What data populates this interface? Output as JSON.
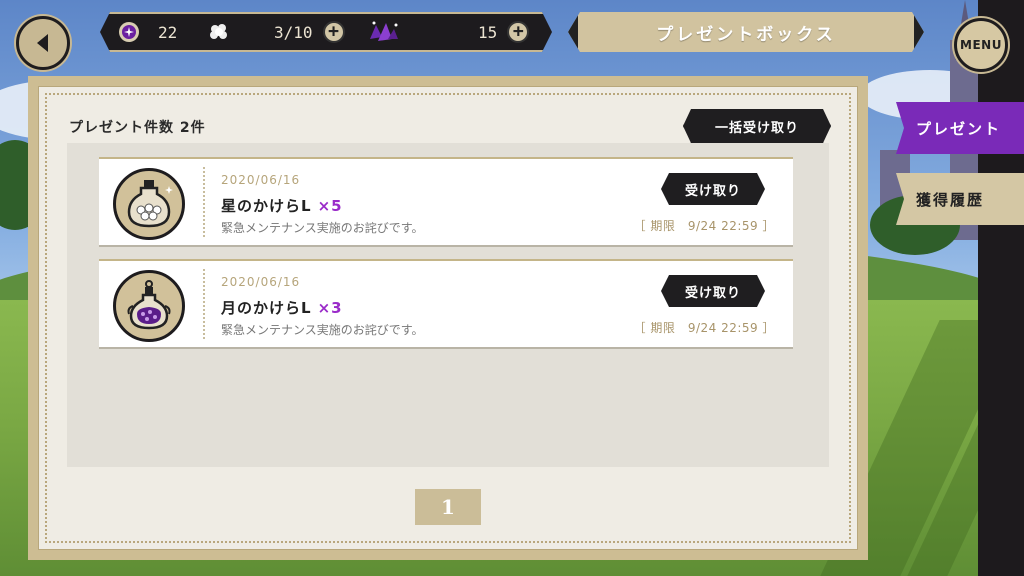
{
  "header": {
    "title": "プレゼントボックス",
    "menu_label": "MENU"
  },
  "currencies": [
    {
      "icon": "orb-icon",
      "value": "22"
    },
    {
      "icon": "flower-icon",
      "value": "3/10"
    },
    {
      "icon": "crystal-icon",
      "value": "15"
    }
  ],
  "tabs": [
    {
      "label": "プレゼント",
      "active": true
    },
    {
      "label": "獲得履歴",
      "active": false
    }
  ],
  "panel": {
    "count_label": "プレゼント件数 2件",
    "bulk_button": "一括受け取り"
  },
  "items": [
    {
      "icon": "star-fragment-bottle-icon",
      "date": "2020/06/16",
      "name": "星のかけらL",
      "qty": "×5",
      "desc": "緊急メンテナンス実施のお詫びです。",
      "button": "受け取り",
      "expiry": "［ 期限　9/24 22:59 ］"
    },
    {
      "icon": "moon-fragment-bottle-icon",
      "date": "2020/06/16",
      "name": "月のかけらL",
      "qty": "×3",
      "desc": "緊急メンテナンス実施のお詫びです。",
      "button": "受け取り",
      "expiry": "［ 期限　9/24 22:59 ］"
    }
  ],
  "pagination": {
    "current": "1"
  },
  "colors": {
    "accent_purple": "#7a2ab8",
    "gold": "#cdbd93",
    "dark": "#1f1e20"
  }
}
